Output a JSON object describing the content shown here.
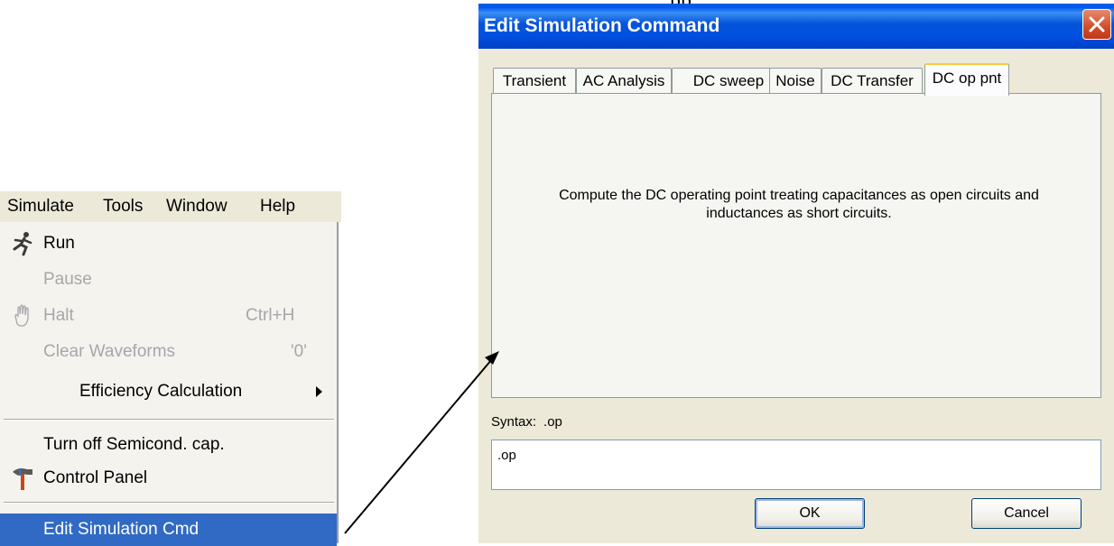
{
  "page_fragment": "pp",
  "menu": {
    "bar": [
      "Simulate",
      "Tools",
      "Window",
      "Help"
    ],
    "items": {
      "run": "Run",
      "pause": "Pause",
      "halt": "Halt",
      "halt_shortcut": "Ctrl+H",
      "clear_waveforms": "Clear Waveforms",
      "clear_waveforms_shortcut": "'0'",
      "efficiency": "Efficiency Calculation",
      "semicond": "Turn off Semicond. cap.",
      "control_panel": "Control Panel",
      "edit_sim_cmd": "Edit Simulation Cmd"
    },
    "icons": {
      "run": "running-man-icon",
      "halt": "hand-icon",
      "control_panel": "hammer-icon"
    }
  },
  "dialog": {
    "title": "Edit Simulation Command",
    "tabs": [
      "Transient",
      "AC Analysis",
      "DC sweep",
      "Noise",
      "DC Transfer",
      "DC op pnt"
    ],
    "active_tab": "DC op pnt",
    "description_line1": "Compute the DC operating point treating capacitances as open circuits and",
    "description_line2": "inductances as short circuits.",
    "syntax_label": "Syntax:",
    "syntax_value": ".op",
    "command_value": ".op",
    "ok_label": "OK",
    "cancel_label": "Cancel"
  },
  "colors": {
    "title_blue": "#0451d8",
    "highlight": "#316ac5",
    "close_red": "#d24d28",
    "active_tab_accent": "#ffc83c"
  }
}
